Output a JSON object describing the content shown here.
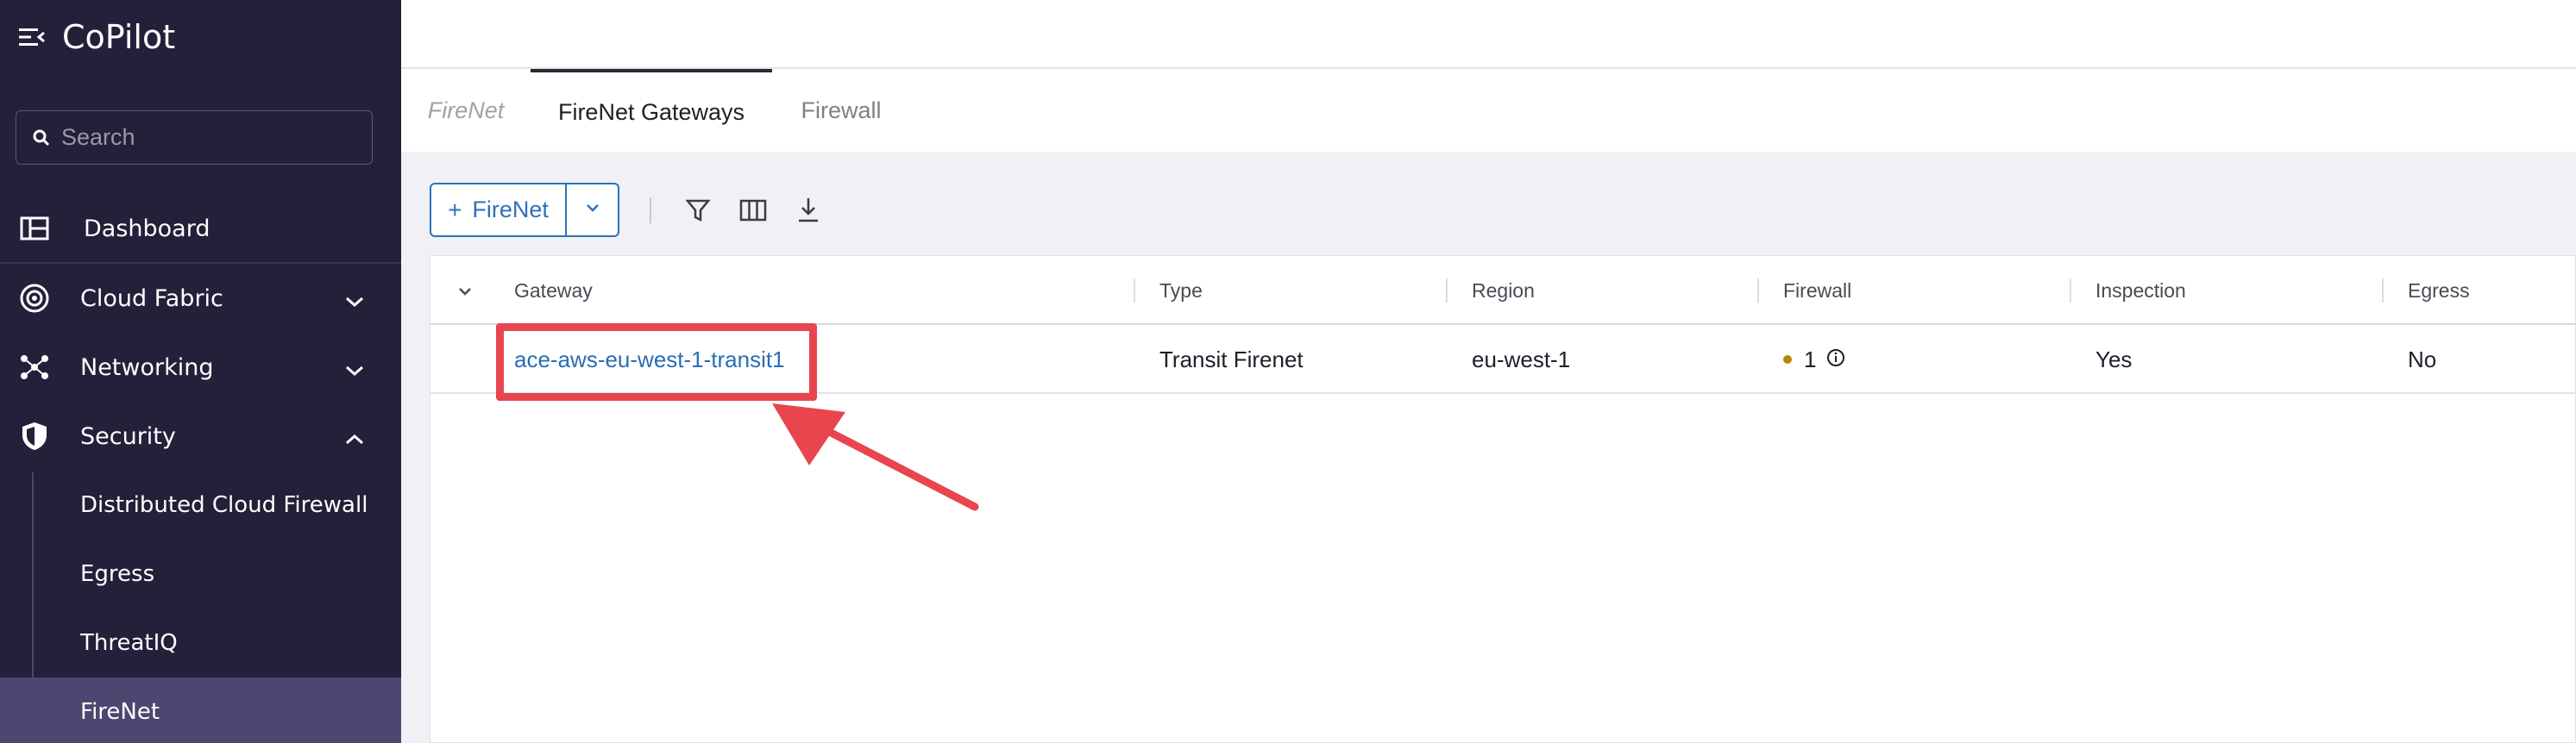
{
  "sidebar": {
    "brand": "CoPilot",
    "search_placeholder": "Search",
    "items": [
      {
        "label": "Dashboard"
      },
      {
        "label": "Cloud Fabric"
      },
      {
        "label": "Networking"
      },
      {
        "label": "Security"
      }
    ],
    "security_sub": [
      {
        "label": "Distributed Cloud Firewall"
      },
      {
        "label": "Egress"
      },
      {
        "label": "ThreatIQ"
      },
      {
        "label": "FireNet"
      }
    ]
  },
  "tabs": {
    "crumb": "FireNet",
    "active": "FireNet Gateways",
    "other": "Firewall"
  },
  "toolbar": {
    "add_label": "FireNet"
  },
  "table": {
    "columns": [
      "Gateway",
      "Type",
      "Region",
      "Firewall",
      "Inspection",
      "Egress"
    ],
    "rows": [
      {
        "gateway": "ace-aws-eu-west-1-transit1",
        "type": "Transit Firenet",
        "region": "eu-west-1",
        "firewall": "1",
        "inspection": "Yes",
        "egress": "No"
      }
    ]
  },
  "colors": {
    "sidebar_bg": "#23203a",
    "accent": "#2d73b8",
    "highlight": "#e8454f",
    "status_dot": "#b8860b"
  }
}
